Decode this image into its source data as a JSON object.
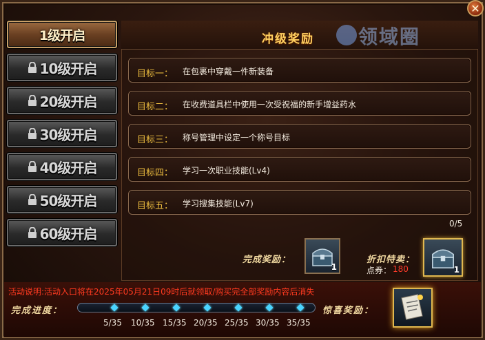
{
  "close_label": "✕",
  "sidebar": {
    "tabs": [
      {
        "label": "1级开启",
        "active": true,
        "locked": false
      },
      {
        "label": "10级开启",
        "active": false,
        "locked": true
      },
      {
        "label": "20级开启",
        "active": false,
        "locked": true
      },
      {
        "label": "30级开启",
        "active": false,
        "locked": true
      },
      {
        "label": "40级开启",
        "active": false,
        "locked": true
      },
      {
        "label": "50级开启",
        "active": false,
        "locked": true
      },
      {
        "label": "60级开启",
        "active": false,
        "locked": true
      }
    ]
  },
  "panel": {
    "title": "冲级奖励",
    "watermark": "领域圈",
    "goals": [
      {
        "key": "目标一：",
        "text": "在包裹中穿戴一件新装备"
      },
      {
        "key": "目标二：",
        "text": "在收费道具栏中使用一次受祝福的新手增益药水"
      },
      {
        "key": "目标三：",
        "text": "称号管理中设定一个称号目标"
      },
      {
        "key": "目标四：",
        "text": "学习一次职业技能(Lv4)"
      },
      {
        "key": "目标五：",
        "text": "学习搜集技能(Lv7)"
      }
    ],
    "completed_count": "0/5",
    "reward_label": "完成奖励：",
    "reward_qty": "1",
    "discount_label": "折扣特卖：",
    "discount_qty": "1",
    "coupon_label": "点券：",
    "coupon_value": "180"
  },
  "bottom": {
    "notice": "活动说明:活动入口将在2025年05月21日09时后就领取/购买完全部奖励内容后消失",
    "progress_label": "完成进度：",
    "progress_fraction": 0,
    "ticks": [
      "5/35",
      "10/35",
      "15/35",
      "20/35",
      "25/35",
      "30/35",
      "35/35"
    ],
    "surprise_label": "惊喜奖励："
  },
  "colors": {
    "gold": "#f0c040",
    "accent_red": "#ff3a20",
    "progress_blue": "#4ad4ff"
  }
}
